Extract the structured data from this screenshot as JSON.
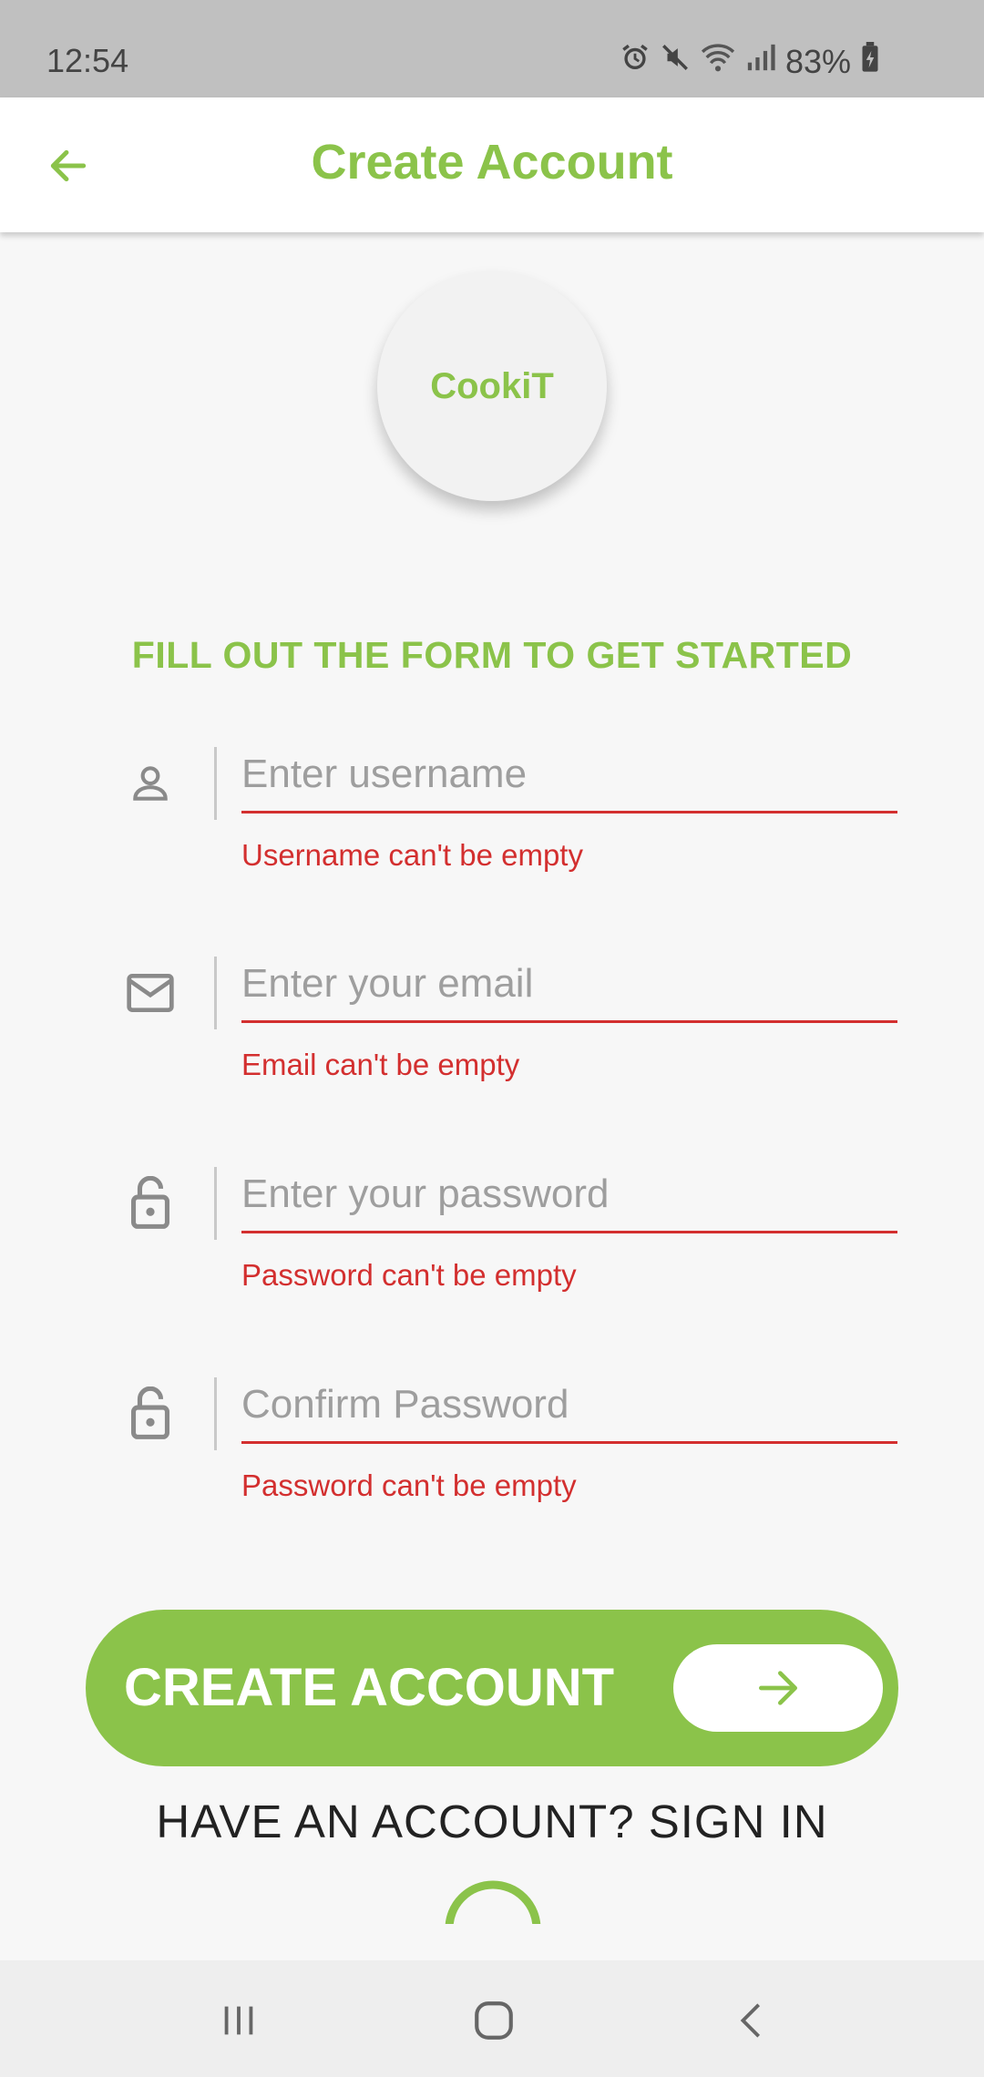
{
  "status_bar": {
    "time": "12:54",
    "battery": "83%",
    "icons": [
      "alarm-icon",
      "mute-icon",
      "wifi-icon",
      "signal-icon",
      "battery-icon"
    ]
  },
  "app_bar": {
    "title": "Create Account",
    "back_icon": "arrow-left-icon"
  },
  "logo": {
    "text": "CookiT"
  },
  "form": {
    "heading": "FILL OUT THE FORM TO GET STARTED",
    "fields": [
      {
        "icon": "person-icon",
        "placeholder": "Enter username",
        "value": "",
        "error": "Username can't be empty"
      },
      {
        "icon": "mail-icon",
        "placeholder": "Enter your email",
        "value": "",
        "error": "Email can't be empty"
      },
      {
        "icon": "lock-open-icon",
        "placeholder": "Enter your password",
        "value": "",
        "error": "Password can't be empty"
      },
      {
        "icon": "lock-open-icon",
        "placeholder": "Confirm Password",
        "value": "",
        "error": "Password can't be empty"
      }
    ]
  },
  "create_button": {
    "label": "CREATE ACCOUNT",
    "icon": "arrow-right-icon"
  },
  "signin_link": {
    "label": "HAVE AN ACCOUNT? SIGN IN"
  },
  "colors": {
    "accent": "#8bc34a",
    "error": "#d32f2f",
    "background": "#f7f7f7"
  },
  "nav_bar": {
    "icons": [
      "recents-icon",
      "home-icon",
      "back-icon"
    ]
  }
}
